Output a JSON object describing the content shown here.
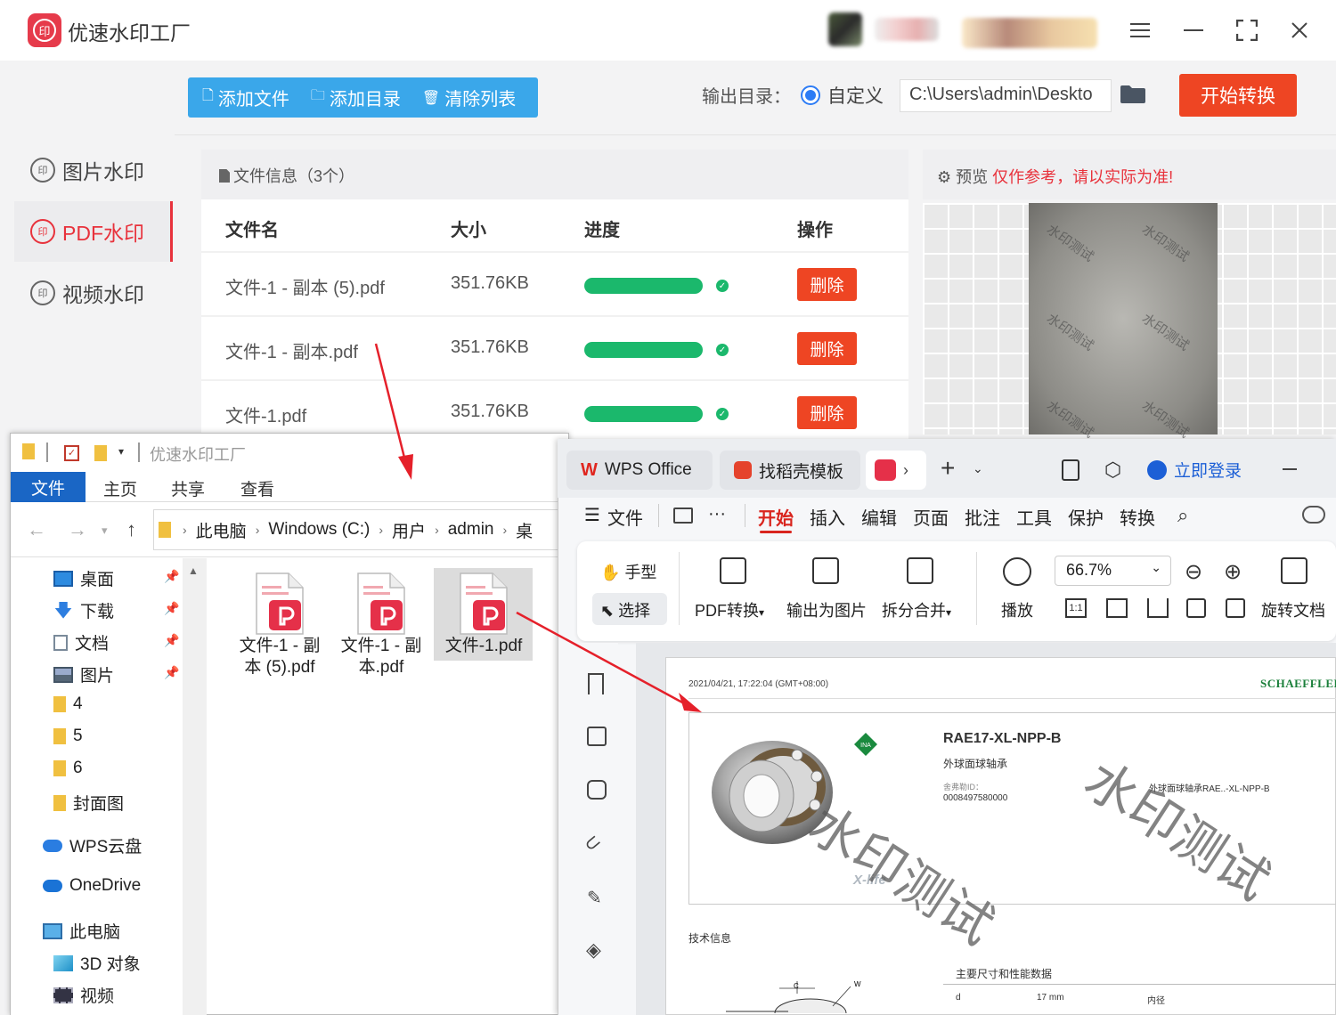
{
  "app": {
    "title": "优速水印工厂",
    "logo_text": "印",
    "window_controls": [
      "menu-icon",
      "minimize-icon",
      "fullscreen-icon",
      "close-icon"
    ]
  },
  "sidebar": {
    "items": [
      {
        "label": "图片水印",
        "active": false
      },
      {
        "label": "PDF水印",
        "active": true
      },
      {
        "label": "视频水印",
        "active": false
      }
    ]
  },
  "toolbar": {
    "add_file": "添加文件",
    "add_dir": "添加目录",
    "clear_list": "清除列表",
    "output_label": "输出目录：",
    "custom_option": "自定义",
    "output_path": "C:\\Users\\admin\\Deskto",
    "start": "开始转换"
  },
  "file_list": {
    "title": "文件信息（3个）",
    "columns": {
      "name": "文件名",
      "size": "大小",
      "progress": "进度",
      "action": "操作"
    },
    "rows": [
      {
        "name": "文件-1 - 副本 (5).pdf",
        "size": "351.76KB",
        "progress": 1.0,
        "action": "删除"
      },
      {
        "name": "文件-1 - 副本.pdf",
        "size": "351.76KB",
        "progress": 1.0,
        "action": "删除"
      },
      {
        "name": "文件-1.pdf",
        "size": "351.76KB",
        "progress": 1.0,
        "action": "删除"
      }
    ]
  },
  "preview": {
    "label": "预览",
    "warning": "仅作参考，请以实际为准!",
    "watermark": "水印测试"
  },
  "explorer": {
    "title": "优速水印工厂",
    "tabs": [
      "文件",
      "主页",
      "共享",
      "查看"
    ],
    "breadcrumb": [
      "此电脑",
      "Windows (C:)",
      "用户",
      "admin",
      "桌"
    ],
    "nav_items": [
      {
        "label": "桌面",
        "pinned": true
      },
      {
        "label": "下载",
        "pinned": true
      },
      {
        "label": "文档",
        "pinned": true
      },
      {
        "label": "图片",
        "pinned": true
      },
      {
        "label": "4",
        "pinned": false
      },
      {
        "label": "5",
        "pinned": false
      },
      {
        "label": "6",
        "pinned": false
      },
      {
        "label": "封面图",
        "pinned": false
      },
      {
        "label": "WPS云盘",
        "pinned": false
      },
      {
        "label": "OneDrive",
        "pinned": false
      },
      {
        "label": "此电脑",
        "pinned": false
      },
      {
        "label": "3D 对象",
        "pinned": false
      },
      {
        "label": "视频",
        "pinned": false
      }
    ],
    "files": [
      {
        "line1": "文件-1 - 副",
        "line2": "本 (5).pdf"
      },
      {
        "line1": "文件-1 - 副",
        "line2": "本.pdf"
      },
      {
        "line1": "文件-1.pdf",
        "line2": ""
      }
    ]
  },
  "wps": {
    "tabs": [
      "WPS Office",
      "找稻壳模板"
    ],
    "login": "立即登录",
    "menu": [
      "文件",
      "开始",
      "插入",
      "编辑",
      "页面",
      "批注",
      "工具",
      "保护",
      "转换"
    ],
    "ribbon": {
      "hand": "手型",
      "select": "选择",
      "pdf_convert": "PDF转换",
      "export_image": "输出为图片",
      "split_merge": "拆分合并",
      "play": "播放",
      "zoom": "66.7%",
      "rotate": "旋转文档"
    },
    "doc": {
      "date": "2021/04/21, 17:22:04 (GMT+08:00)",
      "brand": "SCHAEFFLER",
      "model": "RAE17-XL-NPP-B",
      "desc": "外球面球轴承",
      "id_label": "舍弗勒ID：",
      "id": "0008497580000",
      "desc2": "外球面球轴承RAE..-XL-NPP-B",
      "xlife": "X-life",
      "watermark": "水印测试",
      "tech_info": "技术信息",
      "spec_title": "主要尺寸和性能数据",
      "spec_row": [
        "d",
        "17  mm",
        "内径"
      ]
    }
  }
}
